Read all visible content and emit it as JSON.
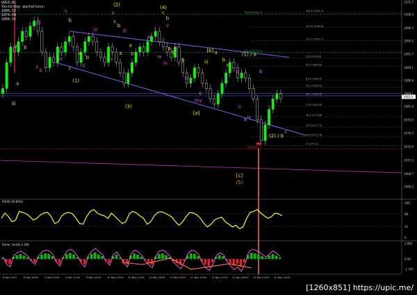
{
  "header": {
    "symbol": "GOLD,H1",
    "yesterday_label": "Yesterday quotations:",
    "yesterday_values": [
      "1089.52",
      "1074.09",
      "1084.51"
    ]
  },
  "chart_data": [
    {
      "type": "line",
      "panel": "price",
      "ylim": [
        1064,
        1102
      ],
      "y_ticks": [
        "1101.7",
        "1099.3",
        "1096.7",
        "1094.2",
        "1091.7",
        "1089.1",
        "1086.6",
        "1084.1",
        "1081.6",
        "1079.0",
        "1076.5",
        "1073.9",
        "1071.3",
        "1068.7",
        "1066.2"
      ],
      "price_label": "1083.4",
      "x_ticks": [
        "6 Nov 2015",
        "6 Nov 18:00",
        "9 Nov 03:00",
        "9 Nov 11:00",
        "9 Nov 19:00",
        "10 Nov 03:00",
        "10 Nov 12:00",
        "10 Nov 20:00",
        "11 Nov 05:00",
        "11 Nov 13:00",
        "11 Nov 21:00",
        "12 Nov 06:00",
        "12 Nov 14:00",
        "12 Nov 22:00"
      ],
      "close": [
        1085,
        1090,
        1093,
        1092,
        1094,
        1096,
        1095,
        1097,
        1098,
        1096,
        1092,
        1089,
        1091,
        1090,
        1093,
        1092,
        1094,
        1095,
        1093,
        1090,
        1092,
        1094,
        1095,
        1094,
        1092,
        1091,
        1090,
        1093,
        1092,
        1090,
        1088,
        1086,
        1088,
        1090,
        1092,
        1093,
        1092,
        1094,
        1095,
        1096,
        1094,
        1093,
        1092,
        1091,
        1093,
        1090,
        1088,
        1086,
        1087,
        1089,
        1088,
        1086,
        1085,
        1083,
        1082,
        1084,
        1086,
        1088,
        1090,
        1089,
        1087,
        1088,
        1087,
        1085,
        1083,
        1079,
        1075,
        1078,
        1081,
        1083,
        1084,
        1083
      ],
      "series": [
        {
          "values": [
            1096,
            1091
          ]
        },
        {
          "values": [
            1090,
            1076
          ]
        }
      ],
      "fib_levels": [
        {
          "label": "161.8 1099.14",
          "value": 1099.6
        },
        {
          "label": "123.6 1096.46",
          "value": 1096.7
        },
        {
          "label": "127.2 1093.77",
          "value": 1094.2
        },
        {
          "label": "100 1090.89",
          "value": 1090.9
        },
        {
          "label": "85.4 1089.83",
          "value": 1089.3
        },
        {
          "label": "61.8 1086.33",
          "value": 1086.6
        },
        {
          "label": "50.0 1085.09",
          "value": 1085.3
        },
        {
          "label": "38.2 1082.39",
          "value": 1083.6
        },
        {
          "label": "23.6 1081.89",
          "value": 1081.6
        },
        {
          "label": "38.2 1079.86",
          "value": 1079.6
        },
        {
          "label": "23.6 1077.70",
          "value": 1077.6
        },
        {
          "label": "23.6 1075.78",
          "value": 1075.8
        },
        {
          "label": "0 1074.09",
          "value": 1074.1
        }
      ],
      "level_labels": [
        {
          "text": "Resistance 2",
          "value": 1099.3
        },
        {
          "text": "Resistance 1",
          "value": 1091.9
        },
        {
          "text": "Support 1",
          "value": 1073.4
        }
      ],
      "wave_labels": [
        {
          "text": "(2)",
          "x": 60,
          "y": 1100.8,
          "color": "#e6e600"
        },
        {
          "text": "(4)",
          "x": 84,
          "y": 1100.3,
          "color": "#e6e600"
        },
        {
          "text": "(1)",
          "x": 39,
          "y": 1086.2,
          "color": "#e6e600"
        },
        {
          "text": "(3)",
          "x": 66,
          "y": 1081.3,
          "color": "#e6e600"
        },
        {
          "text": "(1) / a",
          "x": 128,
          "y": 1091.3,
          "color": "#e6e600"
        },
        {
          "text": "(2) / b",
          "x": 142,
          "y": 1075.6,
          "color": "#e6e600"
        },
        {
          "text": "[b]",
          "x": 108,
          "y": 1092.0,
          "color": "#e6e600"
        },
        {
          "text": "[a]",
          "x": 101,
          "y": 1080.0,
          "color": "#e6e600"
        },
        {
          "text": "[c]",
          "x": 123,
          "y": 1068.0,
          "color": "#e6e600"
        },
        {
          "text": "(5)",
          "x": 123,
          "y": 1066.7,
          "color": "#ff8040"
        },
        {
          "text": "iii",
          "x": 7,
          "y": 1081.8,
          "color": "#e6e600"
        },
        {
          "text": "c",
          "x": 34,
          "y": 1099.6,
          "color": "#40c0ff"
        },
        {
          "text": "v",
          "x": 58,
          "y": 1099.2,
          "color": "#ff40ff"
        },
        {
          "text": "b",
          "x": 36,
          "y": 1097.8,
          "color": "#e6e600"
        },
        {
          "text": "c",
          "x": 84,
          "y": 1099.3,
          "color": "#e6e600"
        },
        {
          "text": "b",
          "x": 86,
          "y": 1098.2,
          "color": "#e6e600"
        },
        {
          "text": "iii",
          "x": 20,
          "y": 1097.3,
          "color": "#ff40ff"
        },
        {
          "text": "v",
          "x": 86,
          "y": 1096.8,
          "color": "#ff40ff"
        },
        {
          "text": "c",
          "x": 59,
          "y": 1097.6,
          "color": "#e6e600"
        },
        {
          "text": "b",
          "x": 61,
          "y": 1096.8,
          "color": "#e6e600"
        },
        {
          "text": "a",
          "x": 8,
          "y": 1092.9,
          "color": "#40c0ff"
        },
        {
          "text": "b",
          "x": 13,
          "y": 1092.6,
          "color": "#e6e600"
        },
        {
          "text": "a",
          "x": 9,
          "y": 1085.7,
          "color": "#e6e600"
        },
        {
          "text": "c",
          "x": 21,
          "y": 1088.2,
          "color": "#e6e600"
        },
        {
          "text": "ii",
          "x": 19,
          "y": 1088.8,
          "color": "#ff40ff"
        },
        {
          "text": "iv",
          "x": 31,
          "y": 1090.4,
          "color": "#ff40ff"
        },
        {
          "text": "a",
          "x": 41,
          "y": 1091.5,
          "color": "#e6e600"
        },
        {
          "text": "b",
          "x": 45,
          "y": 1090.7,
          "color": "#e6e600"
        },
        {
          "text": "c",
          "x": 36,
          "y": 1088.6,
          "color": "#e6e600"
        },
        {
          "text": "ii",
          "x": 43,
          "y": 1089.1,
          "color": "#ff40ff"
        },
        {
          "text": "iii",
          "x": 49,
          "y": 1096.0,
          "color": "#ff40ff"
        },
        {
          "text": "iv",
          "x": 57,
          "y": 1090.4,
          "color": "#ff40ff"
        },
        {
          "text": "a",
          "x": 67,
          "y": 1093.0,
          "color": "#e6e600"
        },
        {
          "text": "b",
          "x": 68,
          "y": 1091.4,
          "color": "#e6e600"
        },
        {
          "text": "iii",
          "x": 64,
          "y": 1095.8,
          "color": "#ff40ff"
        },
        {
          "text": "a",
          "x": 62,
          "y": 1091.5,
          "color": "#e6e600"
        },
        {
          "text": "c",
          "x": 68,
          "y": 1088.5,
          "color": "#e6e600"
        },
        {
          "text": "iii",
          "x": 77,
          "y": 1094.6,
          "color": "#ff40ff"
        },
        {
          "text": "iv",
          "x": 82,
          "y": 1090.8,
          "color": "#ff40ff"
        },
        {
          "text": "a",
          "x": 87,
          "y": 1092.4,
          "color": "#e6e600"
        },
        {
          "text": "b",
          "x": 89,
          "y": 1091.6,
          "color": "#e6e600"
        },
        {
          "text": "iv",
          "x": 85,
          "y": 1089.6,
          "color": "#ff40ff"
        },
        {
          "text": "iii",
          "x": 90,
          "y": 1092.2,
          "color": "#ff40ff"
        },
        {
          "text": "b",
          "x": 94,
          "y": 1090.2,
          "color": "#e6e600"
        },
        {
          "text": "ii",
          "x": 98,
          "y": 1086.0,
          "color": "#ff40ff"
        },
        {
          "text": "c",
          "x": 103,
          "y": 1083.8,
          "color": "#e6e600"
        },
        {
          "text": "iii",
          "x": 101,
          "y": 1082.4,
          "color": "#ff40ff"
        },
        {
          "text": "v",
          "x": 103,
          "y": 1082.4,
          "color": "#ff40ff"
        },
        {
          "text": "iv",
          "x": 96,
          "y": 1086.7,
          "color": "#ff40ff"
        },
        {
          "text": "iii",
          "x": 106,
          "y": 1089.8,
          "color": "#e6e600"
        },
        {
          "text": "a",
          "x": 111,
          "y": 1091.7,
          "color": "#e6e600"
        },
        {
          "text": "b",
          "x": 115,
          "y": 1090.2,
          "color": "#e6e600"
        },
        {
          "text": "ii",
          "x": 116,
          "y": 1086.6,
          "color": "#ff40ff"
        },
        {
          "text": "c",
          "x": 117,
          "y": 1089.2,
          "color": "#e6e600"
        },
        {
          "text": "ii",
          "x": 123,
          "y": 1081.2,
          "color": "#ff40ff"
        },
        {
          "text": "ii",
          "x": 122,
          "y": 1087.9,
          "color": "#ff40ff"
        },
        {
          "text": "iv",
          "x": 128,
          "y": 1079.2,
          "color": "#ff40ff"
        },
        {
          "text": "b",
          "x": 134,
          "y": 1088.0,
          "color": "#40c0ff"
        },
        {
          "text": "a",
          "x": 126,
          "y": 1078.8,
          "color": "#40c0ff"
        },
        {
          "text": "c",
          "x": 147,
          "y": 1076.4,
          "color": "#40c0ff"
        }
      ]
    },
    {
      "type": "line",
      "panel": "rsi",
      "title": "RSI(9) 49.8914",
      "ylim": [
        0,
        100
      ],
      "y_ticks": [
        "100",
        "68",
        "32",
        "0"
      ],
      "values": [
        55,
        70,
        60,
        45,
        50,
        75,
        72,
        68,
        60,
        50,
        55,
        65,
        70,
        72,
        60,
        40,
        45,
        62,
        70,
        72,
        68,
        55,
        40,
        38,
        60,
        75,
        80,
        70,
        65,
        62,
        55,
        70,
        60,
        50,
        40,
        45,
        68,
        75,
        70,
        62,
        55,
        38,
        45,
        62,
        72,
        74,
        70,
        65,
        58,
        45,
        35,
        45,
        60,
        72,
        70,
        65,
        55,
        40,
        30,
        38,
        50,
        55,
        58,
        45,
        38,
        30,
        35,
        25,
        30,
        55,
        72,
        75,
        80,
        70,
        62,
        55,
        60,
        70,
        68,
        62
      ]
    },
    {
      "type": "bar",
      "panel": "fisher",
      "title": "Fisher_Yur4ik 0.196",
      "ylim": [
        -2,
        2.9
      ],
      "y_ticks": [
        "2.865",
        "0.00",
        "-1.797"
      ],
      "values": [
        0.2,
        -0.6,
        -0.9,
        0.4,
        0.7,
        0.9,
        0.6,
        0.3,
        -0.3,
        -0.6,
        0.4,
        0.8,
        1.0,
        0.9,
        0.5,
        -0.4,
        -0.8,
        0.3,
        0.9,
        1.1,
        0.8,
        0.3,
        -0.5,
        -0.9,
        0.4,
        0.9,
        1.2,
        0.8,
        0.5,
        -0.3,
        -0.7,
        0.5,
        0.8,
        0.2,
        -0.5,
        -0.9,
        0.6,
        1.0,
        0.8,
        0.4,
        -0.2,
        -0.7,
        -1.0,
        0.4,
        0.9,
        1.0,
        0.7,
        0.3,
        -0.4,
        -0.8,
        -1.1,
        -0.3,
        0.6,
        1.0,
        0.9,
        0.5,
        -0.4,
        -1.0,
        -1.3,
        -0.6,
        0.4,
        0.7,
        0.5,
        -0.3,
        -0.8,
        -1.2,
        -0.9,
        -1.4,
        -0.6,
        0.7,
        1.1,
        1.0,
        0.8,
        0.5,
        0.2,
        0.6,
        0.9,
        0.6,
        0.3
      ]
    }
  ],
  "watermark": "[1260x851] https://upic.me/"
}
